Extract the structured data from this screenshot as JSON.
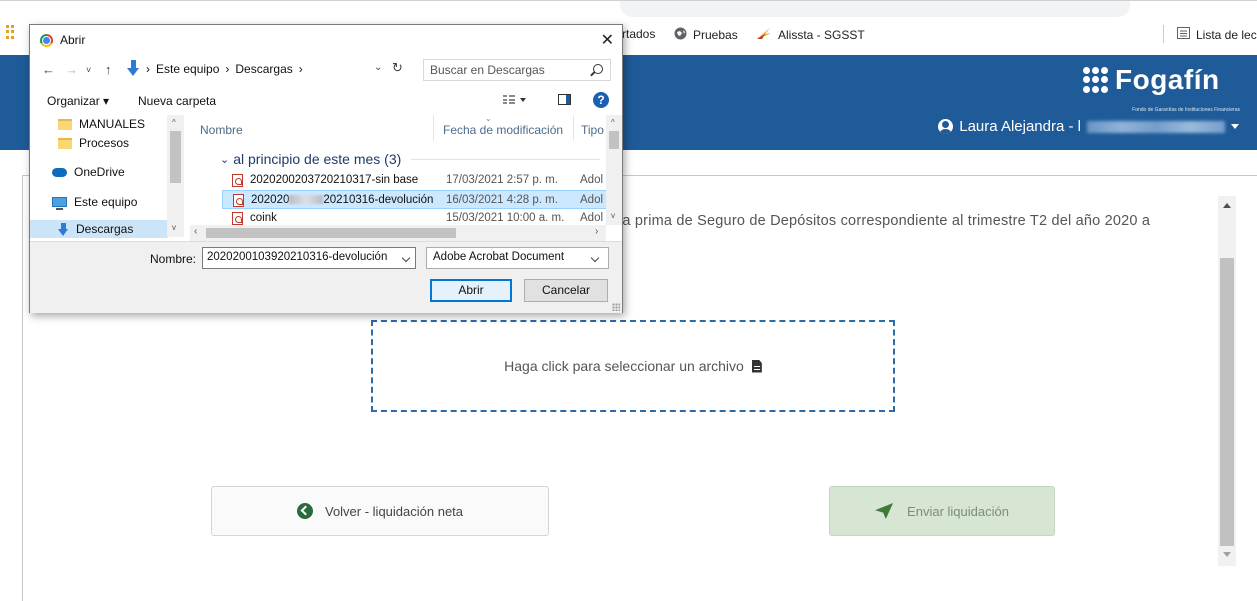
{
  "bookmarks": {
    "items": [
      {
        "label": "rtados",
        "icon": "bookmark-fragment"
      },
      {
        "label": "Pruebas",
        "icon": "globe-icon"
      },
      {
        "label": "Alissta - SGSST",
        "icon": "alissta-icon"
      }
    ],
    "reading_list": "Lista de lec"
  },
  "header": {
    "brand_name": "Fogafín",
    "brand_subtitle": "Fondo de Garantías de Instituciones Financieras",
    "user_name": "Laura Alejandra - l",
    "brand_color": "#1f5b98"
  },
  "main": {
    "description": "la prima de Seguro de Depósitos correspondiente al trimestre T2 del año 2020 a",
    "dropzone_label": "Haga click para seleccionar un archivo",
    "back_button": "Volver - liquidación neta",
    "send_button": "Enviar liquidación"
  },
  "dialog": {
    "title": "Abrir",
    "breadcrumb": [
      "Este equipo",
      "Descargas"
    ],
    "search_placeholder": "Buscar en Descargas",
    "toolbar": {
      "organize": "Organizar ▾",
      "new_folder": "Nueva carpeta",
      "help": "?"
    },
    "nav_pane": [
      {
        "label": "MANUALES",
        "icon": "folder-icon"
      },
      {
        "label": "Procesos",
        "icon": "folder-icon"
      },
      {
        "label": "OneDrive",
        "icon": "cloud-icon"
      },
      {
        "label": "Este equipo",
        "icon": "computer-icon"
      },
      {
        "label": "Descargas",
        "icon": "download-icon"
      }
    ],
    "columns": {
      "name": "Nombre",
      "date": "Fecha de modificación",
      "type": "Tipo"
    },
    "group_label": "al principio de este mes (3)",
    "files": [
      {
        "name_start": "2020200203720210317-sin base",
        "name_end": "",
        "date": "17/03/2021 2:57 p. m.",
        "type": "Adol"
      },
      {
        "name_start": "202020",
        "name_end": "20210316-devolución",
        "date": "16/03/2021 4:28 p. m.",
        "type": "Adol"
      },
      {
        "name_start": "coink",
        "name_end": "",
        "date": "15/03/2021 10:00 a. m.",
        "type": "Adol"
      }
    ],
    "filename_label": "Nombre:",
    "filename_value": "2020200103920210316-devolución",
    "filetype": "Adobe Acrobat Document",
    "open_button": "Abrir",
    "cancel_button": "Cancelar"
  }
}
